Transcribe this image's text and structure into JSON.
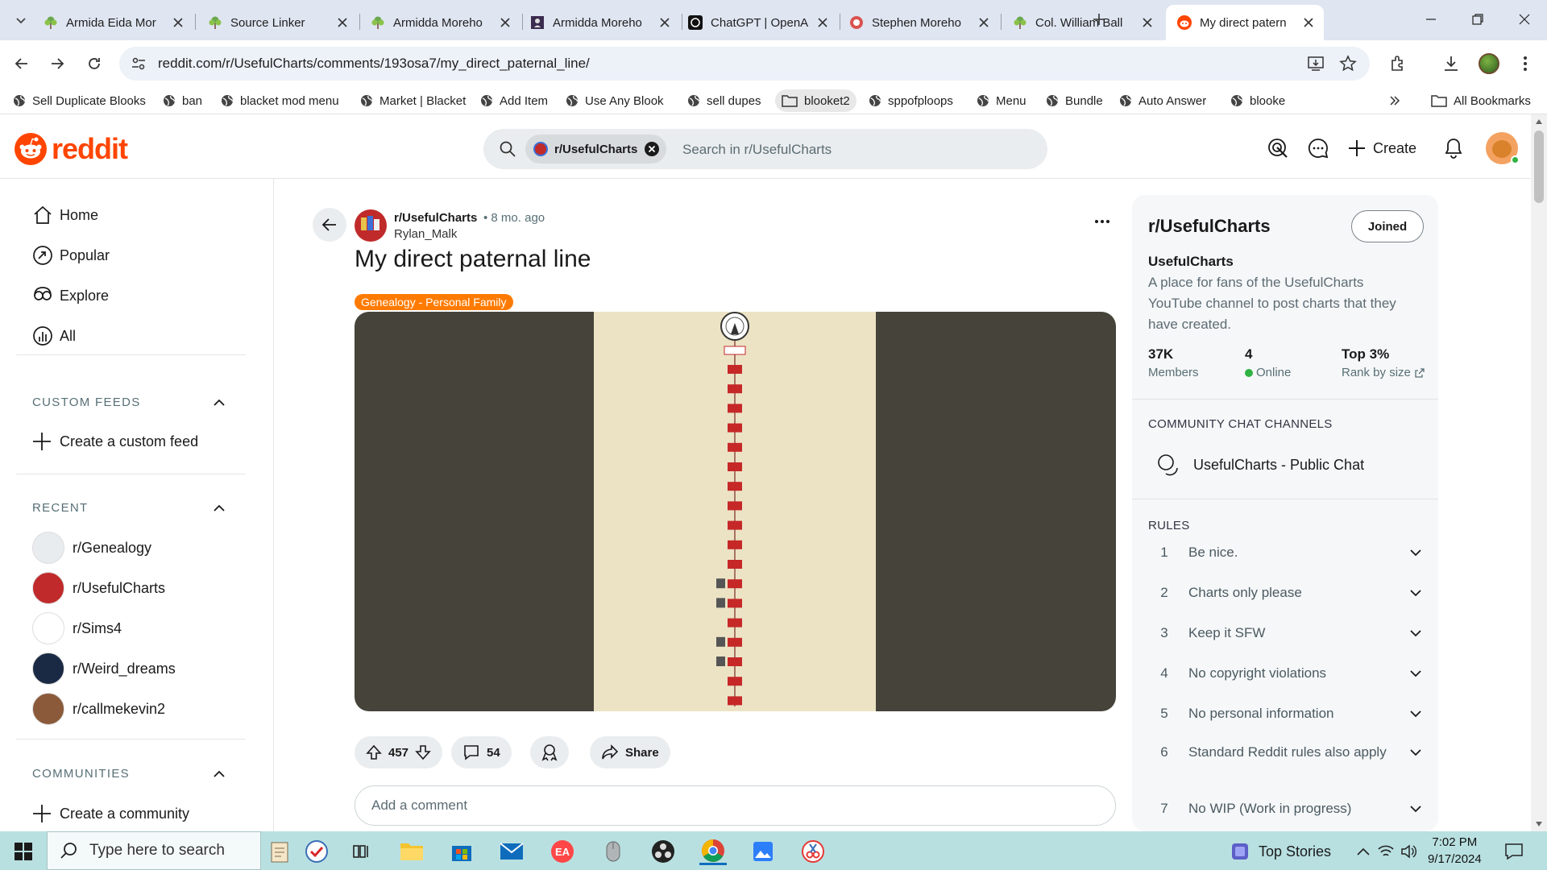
{
  "browser": {
    "tabs": [
      {
        "title": "Armida Eida Mor",
        "icon": "tree-icon",
        "active": false
      },
      {
        "title": "Source Linker",
        "icon": "tree-icon",
        "active": false
      },
      {
        "title": "Armidda Moreho",
        "icon": "tree-icon",
        "active": false
      },
      {
        "title": "Armidda Moreho",
        "icon": "findagrave-icon",
        "active": false
      },
      {
        "title": "ChatGPT | OpenA",
        "icon": "chatgpt-icon",
        "active": false
      },
      {
        "title": "Stephen Moreho",
        "icon": "red-circle-icon",
        "active": false
      },
      {
        "title": "Col. William Ball",
        "icon": "tree-icon",
        "active": false
      },
      {
        "title": "My direct patern",
        "icon": "reddit-icon",
        "active": true
      }
    ],
    "url": "reddit.com/r/UsefulCharts/comments/193osa7/my_direct_paternal_line/",
    "bookmarks": [
      {
        "label": "Sell Duplicate Blooks",
        "type": "globe"
      },
      {
        "label": "ban",
        "type": "globe"
      },
      {
        "label": "blacket mod menu",
        "type": "globe"
      },
      {
        "label": "Market | Blacket",
        "type": "globe"
      },
      {
        "label": "Add Item",
        "type": "globe"
      },
      {
        "label": "Use Any Blook",
        "type": "globe"
      },
      {
        "label": "sell dupes",
        "type": "globe"
      },
      {
        "label": "blooket2",
        "type": "folder"
      },
      {
        "label": "sppofploops",
        "type": "globe"
      },
      {
        "label": "Menu",
        "type": "globe"
      },
      {
        "label": "Bundle",
        "type": "globe"
      },
      {
        "label": "Auto Answer",
        "type": "globe"
      },
      {
        "label": "blooke",
        "type": "globe"
      }
    ],
    "all_bookmarks": "All Bookmarks"
  },
  "header": {
    "logo": "reddit",
    "search_chip": "r/UsefulCharts",
    "search_placeholder": "Search in r/UsefulCharts",
    "create_label": "Create"
  },
  "leftnav": {
    "main": [
      {
        "label": "Home",
        "icon": "home-icon"
      },
      {
        "label": "Popular",
        "icon": "popular-icon"
      },
      {
        "label": "Explore",
        "icon": "explore-icon"
      },
      {
        "label": "All",
        "icon": "all-icon"
      }
    ],
    "custom_feeds_title": "CUSTOM FEEDS",
    "create_feed": "Create a custom feed",
    "recent_title": "RECENT",
    "recent": [
      {
        "label": "r/Genealogy",
        "color": "#e9ecef"
      },
      {
        "label": "r/UsefulCharts",
        "color": "#c02a2a"
      },
      {
        "label": "r/Sims4",
        "color": "#ffffff"
      },
      {
        "label": "r/Weird_dreams",
        "color": "#1b2a44"
      },
      {
        "label": "r/callmekevin2",
        "color": "#8a5a3a"
      }
    ],
    "communities_title": "COMMUNITIES",
    "create_community": "Create a community"
  },
  "post": {
    "subreddit": "r/UsefulCharts",
    "time": "• 8 mo. ago",
    "author": "Rylan_Malk",
    "title": "My direct paternal line",
    "flair": "Genealogy - Personal Family",
    "flair_color": "#ff7b00",
    "votes": "457",
    "comments": "54",
    "share_label": "Share",
    "comment_placeholder": "Add a comment"
  },
  "sidebar": {
    "name": "r/UsefulCharts",
    "joined_label": "Joined",
    "title": "UsefulCharts",
    "description": "A place for fans of the UsefulCharts YouTube channel to post charts that they have created.",
    "stats": [
      {
        "value": "37K",
        "label": "Members"
      },
      {
        "value": "4",
        "label": "Online"
      },
      {
        "value": "Top 3%",
        "label": "Rank by size"
      }
    ],
    "chat_section": "COMMUNITY CHAT CHANNELS",
    "chat_channel": "UsefulCharts - Public Chat",
    "rules_section": "RULES",
    "rules": [
      {
        "n": "1",
        "text": "Be nice."
      },
      {
        "n": "2",
        "text": "Charts only please"
      },
      {
        "n": "3",
        "text": "Keep it SFW"
      },
      {
        "n": "4",
        "text": "No copyright violations"
      },
      {
        "n": "5",
        "text": "No personal information"
      },
      {
        "n": "6",
        "text": "Standard Reddit rules also apply"
      },
      {
        "n": "7",
        "text": "No WIP (Work in progress)"
      }
    ]
  },
  "taskbar": {
    "search_placeholder": "Type here to search",
    "news": "Top Stories",
    "time": "7:02 PM",
    "date": "9/17/2024"
  },
  "colors": {
    "reddit_orange": "#ff4500",
    "online_green": "#2fb344",
    "tab_strip": "#dfe5f1",
    "taskbar": "#b9e0e1"
  }
}
